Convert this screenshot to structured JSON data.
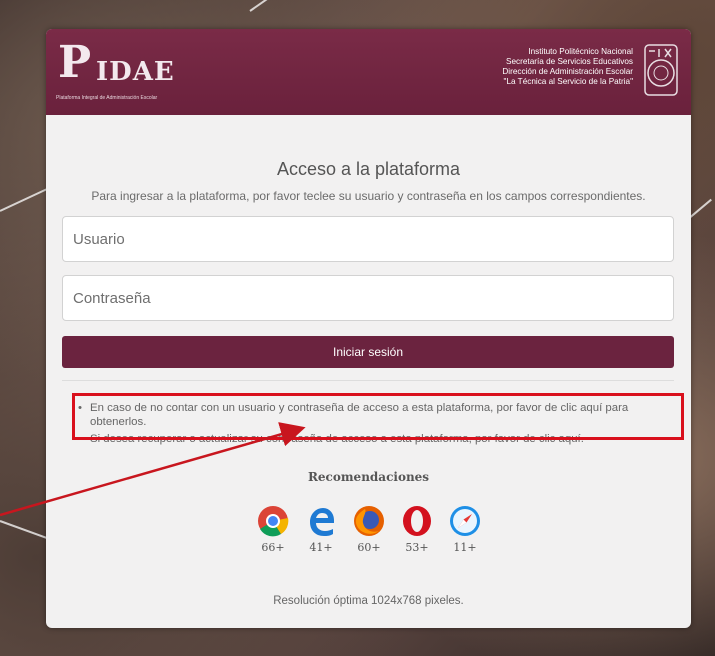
{
  "header": {
    "logo_initial": "P",
    "logo_text": "IDAE",
    "logo_subtitle": "Plataforma Integral de Administración Escolar",
    "institution": "Instituto Politécnico Nacional",
    "secretaria": "Secretaría de Servicios Educativos",
    "direccion": "Dirección de Administración Escolar",
    "motto": "\"La Técnica al Servicio de la Patria\""
  },
  "login": {
    "title": "Acceso a la plataforma",
    "subtitle": "Para ingresar a la plataforma, por favor teclee su usuario y contraseña en los campos correspondientes.",
    "username_placeholder": "Usuario",
    "password_placeholder": "Contraseña",
    "submit_label": "Iniciar sesión"
  },
  "info": {
    "bullet1": "En caso de no contar con un usuario y contraseña de acceso a esta plataforma, por favor de clic aquí para obtenerlos.",
    "bullet2": "Si desea recuperar o actualizar su contraseña de acceso a esta plataforma, por favor de clic aquí."
  },
  "recommendations": {
    "title": "Recomendaciones",
    "browsers": [
      {
        "icon": "chrome-icon",
        "version": "66+"
      },
      {
        "icon": "edge-icon",
        "version": "41+"
      },
      {
        "icon": "firefox-icon",
        "version": "60+"
      },
      {
        "icon": "opera-icon",
        "version": "53+"
      },
      {
        "icon": "safari-icon",
        "version": "11+"
      }
    ],
    "resolution": "Resolución óptima 1024x768 pixeles."
  },
  "colors": {
    "brand": "#6b233f",
    "highlight": "#d9101c"
  }
}
